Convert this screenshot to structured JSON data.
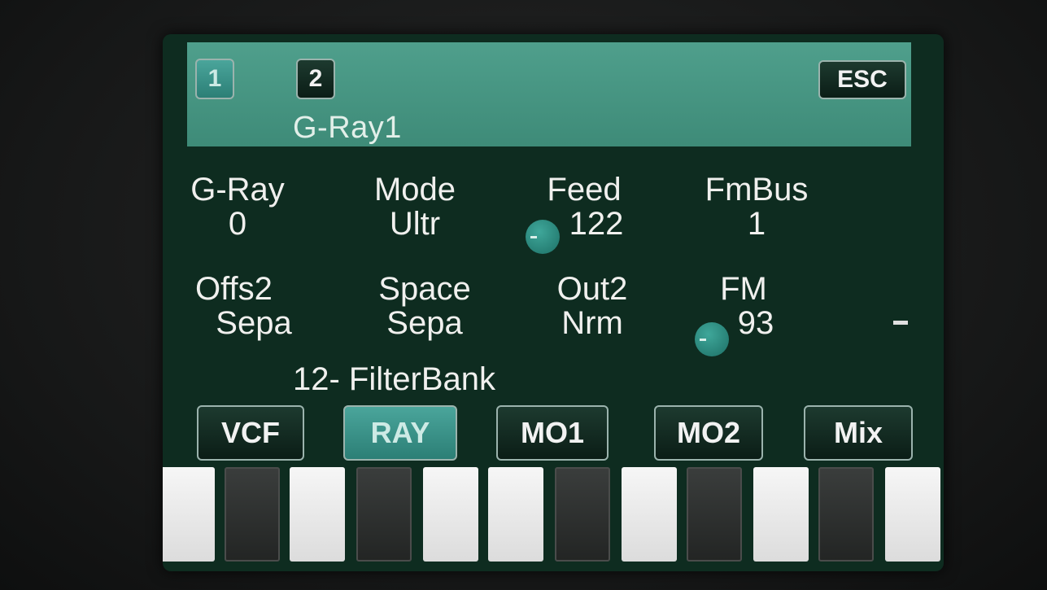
{
  "header": {
    "page_buttons": [
      "1",
      "2"
    ],
    "active_page": "1",
    "esc_label": "ESC",
    "title": "G-Ray1"
  },
  "params": [
    {
      "label": "G-Ray",
      "value": "0",
      "knob": false
    },
    {
      "label": "Mode",
      "value": "Ultr",
      "knob": false
    },
    {
      "label": "Feed",
      "value": "122",
      "knob": true
    },
    {
      "label": "FmBus",
      "value": "1",
      "knob": false
    },
    {
      "label": "Offs2",
      "value": "Sepa",
      "knob": false
    },
    {
      "label": "Space",
      "value": "Sepa",
      "knob": false
    },
    {
      "label": "Out2",
      "value": "Nrm",
      "knob": false
    },
    {
      "label": "FM",
      "value": "93",
      "knob": true
    }
  ],
  "preset_name": "12- FilterBank",
  "tabs": [
    {
      "label": "VCF",
      "active": false
    },
    {
      "label": "RAY",
      "active": true
    },
    {
      "label": "MO1",
      "active": false
    },
    {
      "label": "MO2",
      "active": false
    },
    {
      "label": "Mix",
      "active": false
    }
  ],
  "keyboard": [
    "white",
    "black",
    "white",
    "black",
    "white",
    "white",
    "black",
    "white",
    "black",
    "white",
    "black",
    "white"
  ],
  "colors": {
    "header": "#4f9f8c",
    "screen": "#0e2c20",
    "active_button": "#3a948a",
    "text": "#f0f0ee"
  }
}
